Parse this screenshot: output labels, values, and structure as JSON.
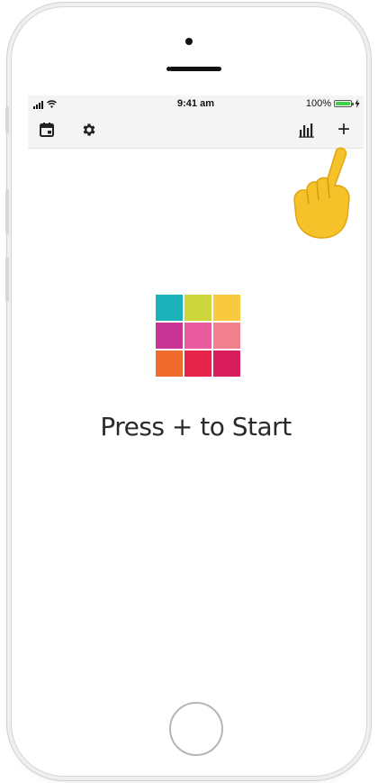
{
  "status_bar": {
    "time": "9:41 am",
    "battery_percent": "100%",
    "battery_level": 1.0
  },
  "toolbar": {
    "left_icons": [
      "calendar-icon",
      "gear-icon"
    ],
    "right_icons": [
      "bar-chart-icon",
      "plus-icon"
    ],
    "add_label": "+"
  },
  "main": {
    "prompt": "Press + to Start",
    "logo_colors": [
      "#1bb3b9",
      "#cdd63b",
      "#f9c93f",
      "#c83493",
      "#ea5a9e",
      "#f0808d",
      "#ef6c2c",
      "#e6234b",
      "#d91c5c"
    ]
  },
  "colors": {
    "toolbar_bg": "#f4f4f4",
    "battery_green": "#3fcf4a",
    "hand_emoji": "#f5c229"
  }
}
